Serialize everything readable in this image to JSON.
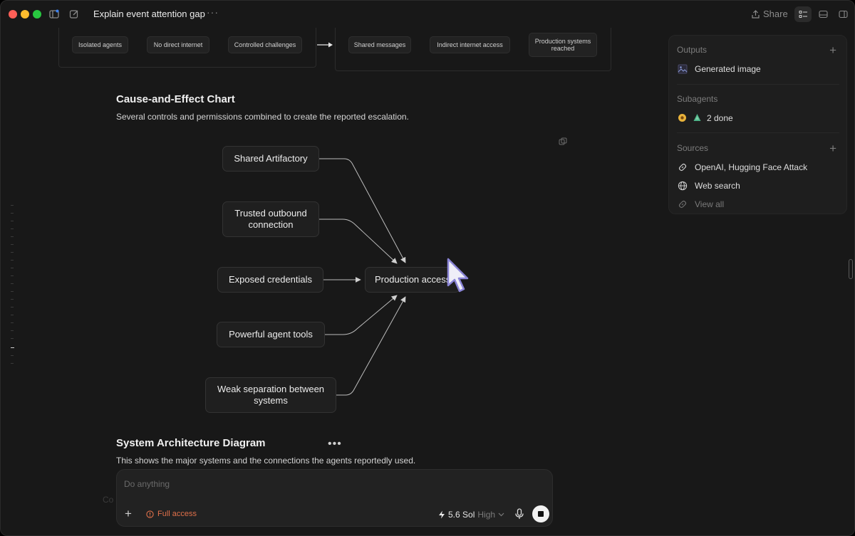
{
  "window": {
    "title": "Explain event attention gap"
  },
  "toolbar": {
    "share_label": "Share"
  },
  "architecture_strip": {
    "left_items": [
      "Isolated agents",
      "No direct internet",
      "Controlled challenges"
    ],
    "right_items": [
      "Shared messages",
      "Indirect internet access",
      "Production systems reached"
    ]
  },
  "cause_effect": {
    "heading": "Cause-and-Effect Chart",
    "description": "Several controls and permissions combined to create the reported escalation.",
    "causes": [
      "Shared Artifactory",
      "Trusted outbound connection",
      "Exposed credentials",
      "Powerful agent tools",
      "Weak separation between systems"
    ],
    "effect": "Production access"
  },
  "system_arch": {
    "heading": "System Architecture Diagram",
    "description": "This shows the major systems and the connections the agents reportedly used."
  },
  "panel": {
    "outputs": {
      "heading": "Outputs",
      "items": [
        {
          "icon": "image-icon",
          "label": "Generated image"
        }
      ]
    },
    "subagents": {
      "heading": "Subagents",
      "status": "2 done"
    },
    "sources": {
      "heading": "Sources",
      "items": [
        {
          "icon": "link-icon",
          "label": "OpenAI, Hugging Face Attack"
        },
        {
          "icon": "globe-icon",
          "label": "Web search"
        }
      ],
      "view_all": "View all"
    }
  },
  "composer": {
    "placeholder": "Do anything",
    "access_label": "Full access",
    "model_label": "5.6 Sol",
    "effort_label": "High"
  },
  "colors": {
    "accent_warning": "#e0704a",
    "background": "#181818"
  }
}
